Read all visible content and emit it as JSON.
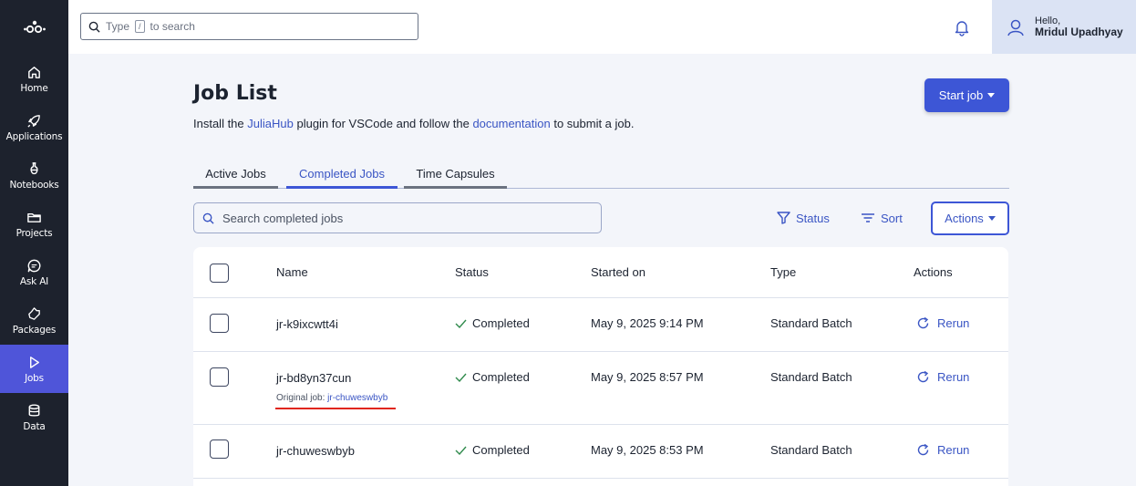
{
  "sidebar": {
    "logo": "JuliaHub logo",
    "items": [
      {
        "label": "Home",
        "icon": "home-icon"
      },
      {
        "label": "Applications",
        "icon": "rocket-icon"
      },
      {
        "label": "Notebooks",
        "icon": "flask-icon"
      },
      {
        "label": "Projects",
        "icon": "folder-icon"
      },
      {
        "label": "Ask AI",
        "icon": "chat-icon"
      },
      {
        "label": "Packages",
        "icon": "package-icon"
      },
      {
        "label": "Jobs",
        "icon": "play-icon",
        "active": true
      },
      {
        "label": "Data",
        "icon": "database-icon"
      }
    ]
  },
  "topbar": {
    "search_prefix": "Type",
    "search_key": "/",
    "search_suffix": "to search",
    "hello": "Hello,",
    "user_name": "Mridul Upadhyay"
  },
  "main": {
    "title": "Job List",
    "intro_1": "Install the ",
    "intro_link_1": "JuliaHub",
    "intro_2": " plugin for VSCode and follow the ",
    "intro_link_2": "documentation",
    "intro_3": " to submit a job.",
    "start_job": "Start job",
    "tabs": [
      "Active Jobs",
      "Completed Jobs",
      "Time Capsules"
    ],
    "active_tab": "Completed Jobs",
    "search_placeholder": "Search completed jobs",
    "status_filter": "Status",
    "sort": "Sort",
    "actions": "Actions"
  },
  "table": {
    "headers": [
      "Name",
      "Status",
      "Started on",
      "Type",
      "Actions"
    ],
    "rows": [
      {
        "name": "jr-k9ixcwtt4i",
        "status": "Completed",
        "started": "May 9, 2025 9:14 PM",
        "type": "Standard Batch",
        "action": "Rerun"
      },
      {
        "name": "jr-bd8yn37cun",
        "status": "Completed",
        "started": "May 9, 2025 8:57 PM",
        "type": "Standard Batch",
        "action": "Rerun",
        "original_label": "Original job: ",
        "original_job": "jr-chuweswbyb"
      },
      {
        "name": "jr-chuweswbyb",
        "status": "Completed",
        "started": "May 9, 2025 8:53 PM",
        "type": "Standard Batch",
        "action": "Rerun"
      }
    ]
  },
  "colors": {
    "sidebar_bg": "#1d222d",
    "sidebar_active": "#4f55d9",
    "accent": "#3d56d6",
    "annotation_red": "#e0261b"
  }
}
